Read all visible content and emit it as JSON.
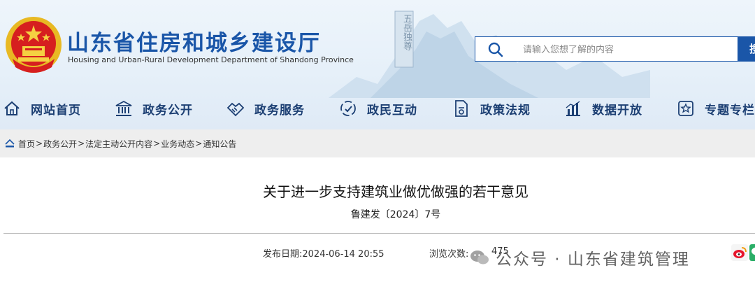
{
  "site": {
    "title": "山东省住房和城乡建设厅",
    "subtitle": "Housing and Urban-Rural Development Department of Shandong Province",
    "mountain_text": "五岳独尊"
  },
  "search": {
    "placeholder": "请输入您想了解的内容",
    "button_label": "搜索"
  },
  "nav": {
    "items": [
      {
        "label": "网站首页",
        "icon": "home-icon"
      },
      {
        "label": "政务公开",
        "icon": "government-building-icon"
      },
      {
        "label": "政务服务",
        "icon": "handshake-icon"
      },
      {
        "label": "政民互动",
        "icon": "interaction-icon"
      },
      {
        "label": "政策法规",
        "icon": "policy-document-icon"
      },
      {
        "label": "数据开放",
        "icon": "data-chart-icon"
      },
      {
        "label": "专题专栏",
        "icon": "topic-icon"
      }
    ]
  },
  "breadcrumb": {
    "items": [
      "首页",
      "政务公开",
      "法定主动公开内容",
      "业务动态",
      "通知公告"
    ],
    "separator": ">"
  },
  "article": {
    "title": "关于进一步支持建筑业做优做强的若干意见",
    "doc_number": "鲁建发〔2024〕7号",
    "publish_date": "发布日期:2024-06-14 20:55",
    "views_label": "浏览次数:",
    "views_count": "475"
  },
  "watermark": {
    "text": "公众号 · 山东省建筑管理"
  },
  "colors": {
    "brand_blue": "#1a56a8",
    "nav_text": "#1c3f73",
    "breadcrumb_bg": "#eeeeee"
  }
}
